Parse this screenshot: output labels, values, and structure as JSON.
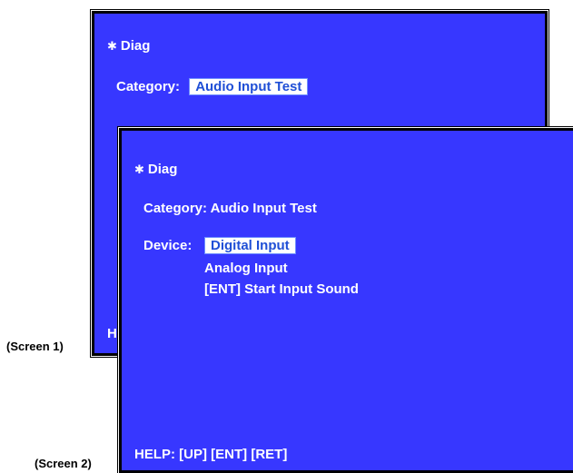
{
  "colors": {
    "screen_bg": "#3737ff",
    "text": "#ffffff",
    "highlight_bg": "#ffffff",
    "highlight_text": "#1f4fd6"
  },
  "screen1": {
    "caption": "(Screen 1)",
    "title_icon": "bullet-icon",
    "title": "Diag",
    "category_label": "Category:",
    "category_value": "Audio Input Test",
    "help_fragment": "H"
  },
  "screen2": {
    "caption": "(Screen 2)",
    "title_icon": "bullet-icon",
    "title": "Diag",
    "category_label": "Category:",
    "category_value": "Audio Input Test",
    "device_label": "Device:",
    "device_options": [
      "Digital Input",
      "Analog Input",
      "[ENT] Start Input Sound"
    ],
    "selected_option": "Digital Input",
    "help": "HELP: [UP] [ENT] [RET]"
  }
}
